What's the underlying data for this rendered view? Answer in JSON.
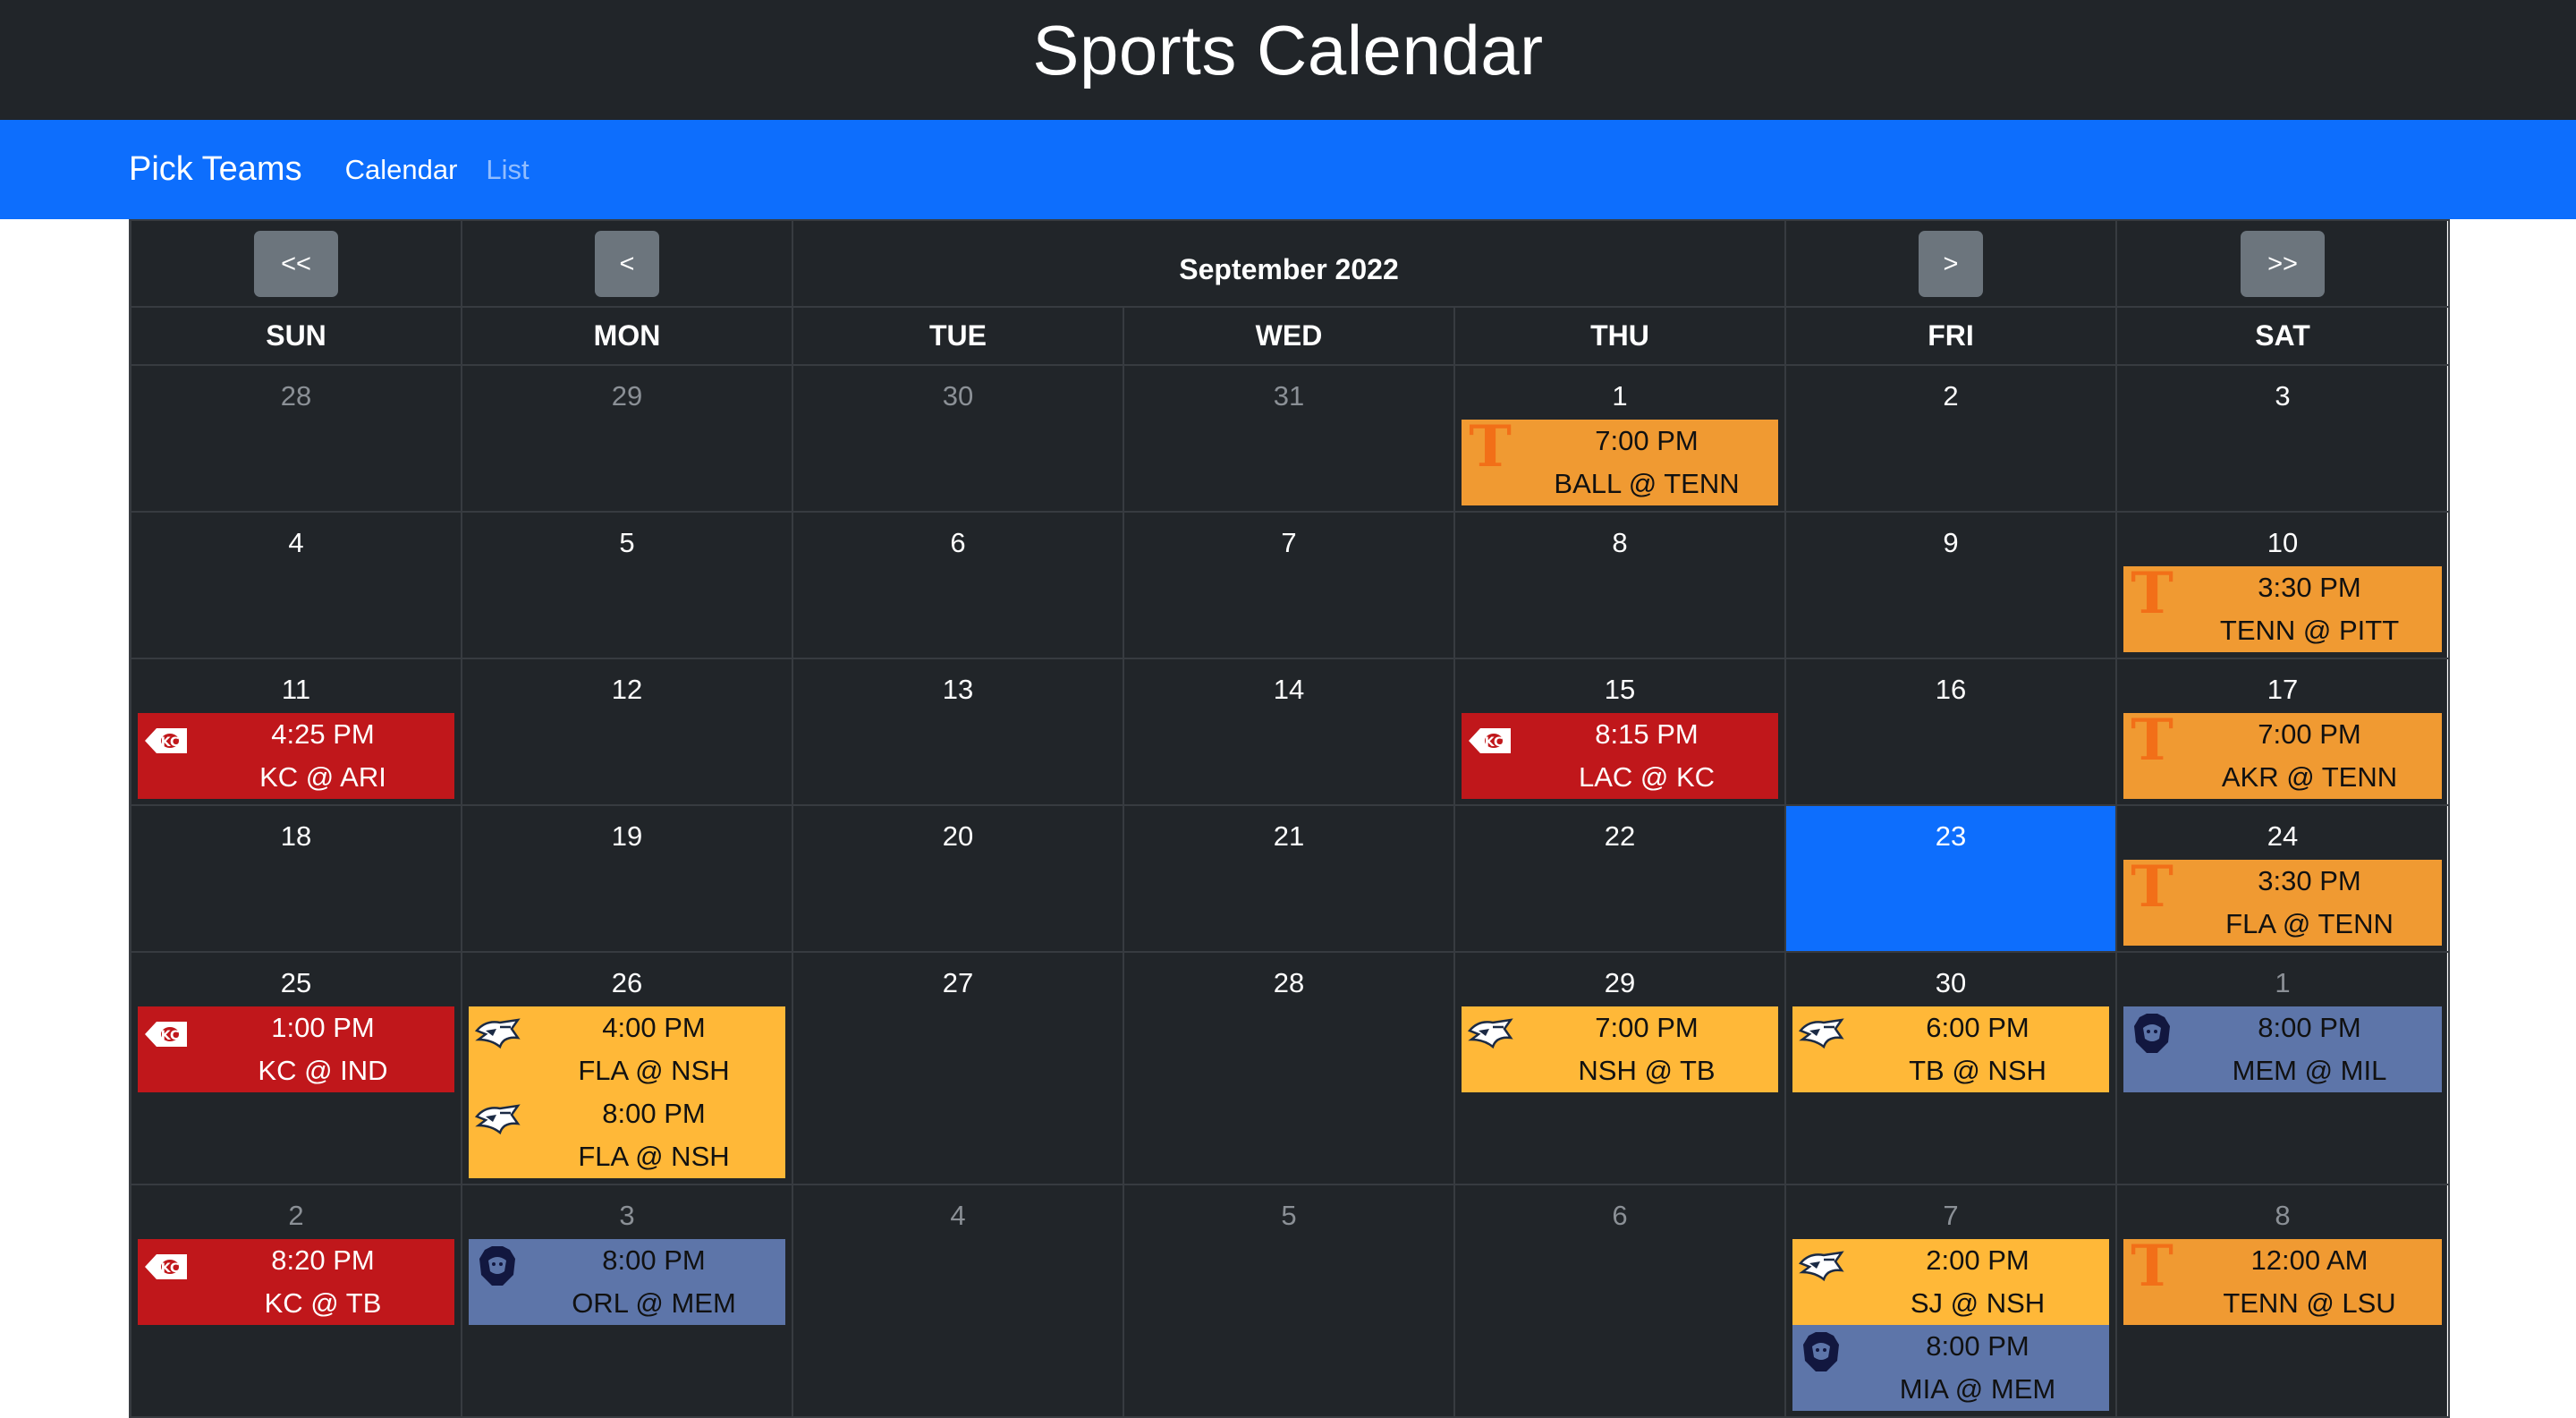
{
  "header": {
    "title": "Sports Calendar"
  },
  "navbar": {
    "brand": "Pick Teams",
    "links": [
      "Calendar",
      "List"
    ]
  },
  "calendar": {
    "month_label": "September 2022",
    "buttons": {
      "prev_year": "<<",
      "prev_month": "<",
      "next_month": ">",
      "next_year": ">>"
    },
    "weekdays": [
      "SUN",
      "MON",
      "TUE",
      "WED",
      "THU",
      "FRI",
      "SAT"
    ],
    "today": "23",
    "weeks": [
      [
        {
          "day": "28",
          "muted": true,
          "events": []
        },
        {
          "day": "29",
          "muted": true,
          "events": []
        },
        {
          "day": "30",
          "muted": true,
          "events": []
        },
        {
          "day": "31",
          "muted": true,
          "events": []
        },
        {
          "day": "1",
          "muted": false,
          "events": [
            {
              "team": "tenn",
              "icon": "tennessee-t-logo-icon",
              "time": "7:00 PM",
              "matchup": "BALL @ TENN"
            }
          ]
        },
        {
          "day": "2",
          "muted": false,
          "events": []
        },
        {
          "day": "3",
          "muted": false,
          "events": []
        }
      ],
      [
        {
          "day": "4",
          "muted": false,
          "events": []
        },
        {
          "day": "5",
          "muted": false,
          "events": []
        },
        {
          "day": "6",
          "muted": false,
          "events": []
        },
        {
          "day": "7",
          "muted": false,
          "events": []
        },
        {
          "day": "8",
          "muted": false,
          "events": []
        },
        {
          "day": "9",
          "muted": false,
          "events": []
        },
        {
          "day": "10",
          "muted": false,
          "events": [
            {
              "team": "tenn",
              "icon": "tennessee-t-logo-icon",
              "time": "3:30 PM",
              "matchup": "TENN @ PITT"
            }
          ]
        }
      ],
      [
        {
          "day": "11",
          "muted": false,
          "events": [
            {
              "team": "kc",
              "icon": "chiefs-arrowhead-logo-icon",
              "time": "4:25 PM",
              "matchup": "KC @ ARI"
            }
          ]
        },
        {
          "day": "12",
          "muted": false,
          "events": []
        },
        {
          "day": "13",
          "muted": false,
          "events": []
        },
        {
          "day": "14",
          "muted": false,
          "events": []
        },
        {
          "day": "15",
          "muted": false,
          "events": [
            {
              "team": "kc",
              "icon": "chiefs-arrowhead-logo-icon",
              "time": "8:15 PM",
              "matchup": "LAC @ KC"
            }
          ]
        },
        {
          "day": "16",
          "muted": false,
          "events": []
        },
        {
          "day": "17",
          "muted": false,
          "events": [
            {
              "team": "tenn",
              "icon": "tennessee-t-logo-icon",
              "time": "7:00 PM",
              "matchup": "AKR @ TENN"
            }
          ]
        }
      ],
      [
        {
          "day": "18",
          "muted": false,
          "events": []
        },
        {
          "day": "19",
          "muted": false,
          "events": []
        },
        {
          "day": "20",
          "muted": false,
          "events": []
        },
        {
          "day": "21",
          "muted": false,
          "events": []
        },
        {
          "day": "22",
          "muted": false,
          "events": []
        },
        {
          "day": "23",
          "muted": false,
          "events": []
        },
        {
          "day": "24",
          "muted": false,
          "events": [
            {
              "team": "tenn",
              "icon": "tennessee-t-logo-icon",
              "time": "3:30 PM",
              "matchup": "FLA @ TENN"
            }
          ]
        }
      ],
      [
        {
          "day": "25",
          "muted": false,
          "events": [
            {
              "team": "kc",
              "icon": "chiefs-arrowhead-logo-icon",
              "time": "1:00 PM",
              "matchup": "KC @ IND"
            }
          ]
        },
        {
          "day": "26",
          "muted": false,
          "events": [
            {
              "team": "nsh",
              "icon": "predators-logo-icon",
              "time": "4:00 PM",
              "matchup": "FLA @ NSH"
            },
            {
              "team": "nsh",
              "icon": "predators-logo-icon",
              "time": "8:00 PM",
              "matchup": "FLA @ NSH"
            }
          ]
        },
        {
          "day": "27",
          "muted": false,
          "events": []
        },
        {
          "day": "28",
          "muted": false,
          "events": []
        },
        {
          "day": "29",
          "muted": false,
          "events": [
            {
              "team": "nsh",
              "icon": "predators-logo-icon",
              "time": "7:00 PM",
              "matchup": "NSH @ TB"
            }
          ]
        },
        {
          "day": "30",
          "muted": false,
          "events": [
            {
              "team": "nsh",
              "icon": "predators-logo-icon",
              "time": "6:00 PM",
              "matchup": "TB @ NSH"
            }
          ]
        },
        {
          "day": "1",
          "muted": true,
          "events": [
            {
              "team": "mem",
              "icon": "grizzlies-logo-icon",
              "time": "8:00 PM",
              "matchup": "MEM @ MIL"
            }
          ]
        }
      ],
      [
        {
          "day": "2",
          "muted": true,
          "events": [
            {
              "team": "kc",
              "icon": "chiefs-arrowhead-logo-icon",
              "time": "8:20 PM",
              "matchup": "KC @ TB"
            }
          ]
        },
        {
          "day": "3",
          "muted": true,
          "events": [
            {
              "team": "mem",
              "icon": "grizzlies-logo-icon",
              "time": "8:00 PM",
              "matchup": "ORL @ MEM"
            }
          ]
        },
        {
          "day": "4",
          "muted": true,
          "events": []
        },
        {
          "day": "5",
          "muted": true,
          "events": []
        },
        {
          "day": "6",
          "muted": true,
          "events": []
        },
        {
          "day": "7",
          "muted": true,
          "events": [
            {
              "team": "nsh",
              "icon": "predators-logo-icon",
              "time": "2:00 PM",
              "matchup": "SJ @ NSH"
            },
            {
              "team": "mem",
              "icon": "grizzlies-logo-icon",
              "time": "8:00 PM",
              "matchup": "MIA @ MEM"
            }
          ]
        },
        {
          "day": "8",
          "muted": true,
          "events": [
            {
              "team": "tenn",
              "icon": "tennessee-t-logo-icon",
              "time": "12:00 AM",
              "matchup": "TENN @ LSU"
            }
          ]
        }
      ]
    ]
  },
  "colors": {
    "header_bg": "#212529",
    "navbar_bg": "#0d6efd",
    "today_bg": "#0d6efd",
    "tenn": "#f09a32",
    "kc": "#c0171b",
    "nsh": "#ffb838",
    "mem": "#5d75a9"
  }
}
